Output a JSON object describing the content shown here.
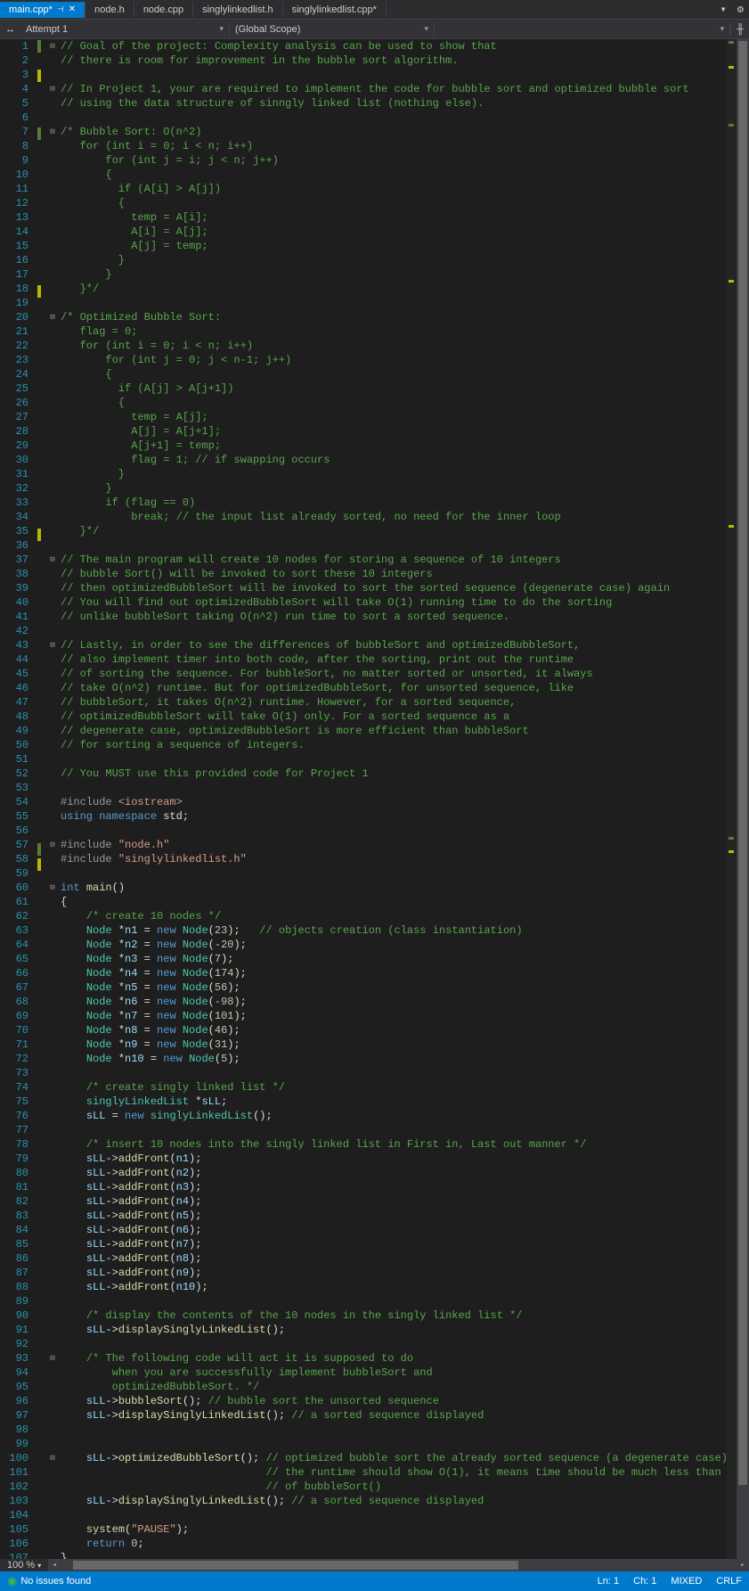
{
  "tabs": {
    "active": "main.cpp*",
    "others": [
      "node.h",
      "node.cpp",
      "singlylinkedlist.h",
      "singlylinkedlist.cpp*"
    ]
  },
  "navbar": {
    "project": "Attempt 1",
    "scope": "(Global Scope)",
    "member": ""
  },
  "statusbar": {
    "issues": "No issues found",
    "zoom": "100 %",
    "line": "Ln: 1",
    "char": "Ch: 1",
    "mode": "MIXED",
    "eol": "CRLF"
  },
  "code": [
    {
      "n": 1,
      "f": "⊟",
      "m": "g",
      "h": "<span class='c-comment'>// Goal of the project: Complexity analysis can be used to show that</span>"
    },
    {
      "n": 2,
      "h": "<span class='c-comment'>// there is room for improvement in the bubble sort algorithm.</span>"
    },
    {
      "n": 3,
      "m": "y",
      "h": ""
    },
    {
      "n": 4,
      "f": "⊟",
      "h": "<span class='c-comment'>// In Project 1, your are required to implement the code for bubble sort and optimized bubble sort</span>"
    },
    {
      "n": 5,
      "h": "<span class='c-comment'>// using the data structure of sinngly linked list (nothing else).</span>"
    },
    {
      "n": 6,
      "h": ""
    },
    {
      "n": 7,
      "f": "⊟",
      "m": "g",
      "h": "<span class='c-comment'>/* Bubble Sort: O(n^2)</span>"
    },
    {
      "n": 8,
      "h": "<span class='c-comment'>   for (int i = 0; i &lt; n; i++)</span>"
    },
    {
      "n": 9,
      "h": "<span class='c-comment'>       for (int j = i; j &lt; n; j++)</span>"
    },
    {
      "n": 10,
      "h": "<span class='c-comment'>       {</span>"
    },
    {
      "n": 11,
      "h": "<span class='c-comment'>         if (A[i] &gt; A[j])</span>"
    },
    {
      "n": 12,
      "h": "<span class='c-comment'>         {</span>"
    },
    {
      "n": 13,
      "h": "<span class='c-comment'>           temp = A[i];</span>"
    },
    {
      "n": 14,
      "h": "<span class='c-comment'>           A[i] = A[j];</span>"
    },
    {
      "n": 15,
      "h": "<span class='c-comment'>           A[j] = temp;</span>"
    },
    {
      "n": 16,
      "h": "<span class='c-comment'>         }</span>"
    },
    {
      "n": 17,
      "h": "<span class='c-comment'>       }</span>"
    },
    {
      "n": 18,
      "m": "y",
      "h": "<span class='c-comment'>   }*/</span>"
    },
    {
      "n": 19,
      "h": ""
    },
    {
      "n": 20,
      "f": "⊟",
      "h": "<span class='c-comment'>/* Optimized Bubble Sort:</span>"
    },
    {
      "n": 21,
      "h": "<span class='c-comment'>   flag = 0;</span>"
    },
    {
      "n": 22,
      "h": "<span class='c-comment'>   for (int i = 0; i &lt; n; i++)</span>"
    },
    {
      "n": 23,
      "h": "<span class='c-comment'>       for (int j = 0; j &lt; n-1; j++)</span>"
    },
    {
      "n": 24,
      "h": "<span class='c-comment'>       {</span>"
    },
    {
      "n": 25,
      "h": "<span class='c-comment'>         if (A[j] &gt; A[j+1])</span>"
    },
    {
      "n": 26,
      "h": "<span class='c-comment'>         {</span>"
    },
    {
      "n": 27,
      "h": "<span class='c-comment'>           temp = A[j];</span>"
    },
    {
      "n": 28,
      "h": "<span class='c-comment'>           A[j] = A[j+1];</span>"
    },
    {
      "n": 29,
      "h": "<span class='c-comment'>           A[j+1] = temp;</span>"
    },
    {
      "n": 30,
      "h": "<span class='c-comment'>           flag = 1; // if swapping occurs</span>"
    },
    {
      "n": 31,
      "h": "<span class='c-comment'>         }</span>"
    },
    {
      "n": 32,
      "h": "<span class='c-comment'>       }</span>"
    },
    {
      "n": 33,
      "h": "<span class='c-comment'>       if (flag == 0)</span>"
    },
    {
      "n": 34,
      "h": "<span class='c-comment'>           break; // the input list already sorted, no need for the inner loop</span>"
    },
    {
      "n": 35,
      "m": "y",
      "h": "<span class='c-comment'>   }*/</span>"
    },
    {
      "n": 36,
      "h": ""
    },
    {
      "n": 37,
      "f": "⊟",
      "h": "<span class='c-comment'>// The main program will create 10 nodes for storing a sequence of 10 integers</span>"
    },
    {
      "n": 38,
      "h": "<span class='c-comment'>// bubble Sort() will be invoked to sort these 10 integers</span>"
    },
    {
      "n": 39,
      "h": "<span class='c-comment'>// then optimizedBubbleSort will be invoked to sort the sorted sequence (degenerate case) again</span>"
    },
    {
      "n": 40,
      "h": "<span class='c-comment'>// You will find out optimizedBubbleSort will take O(1) running time to do the sorting</span>"
    },
    {
      "n": 41,
      "h": "<span class='c-comment'>// unlike bubbleSort taking O(n^2) run time to sort a sorted sequence.</span>"
    },
    {
      "n": 42,
      "h": ""
    },
    {
      "n": 43,
      "f": "⊟",
      "h": "<span class='c-comment'>// Lastly, in order to see the differences of bubbleSort and optimizedBubbleSort,</span>"
    },
    {
      "n": 44,
      "h": "<span class='c-comment'>// also implement timer into both code, after the sorting, print out the runtime</span>"
    },
    {
      "n": 45,
      "h": "<span class='c-comment'>// of sorting the sequence. For bubbleSort, no matter sorted or unsorted, it always</span>"
    },
    {
      "n": 46,
      "h": "<span class='c-comment'>// take O(n^2) runtime. But for optimizedBubbleSort, for unsorted sequence, like</span>"
    },
    {
      "n": 47,
      "h": "<span class='c-comment'>// bubbleSort, it takes O(n^2) runtime. However, for a sorted sequence,</span>"
    },
    {
      "n": 48,
      "h": "<span class='c-comment'>// optimizedBubbleSort will take O(1) only. For a sorted sequence as a</span>"
    },
    {
      "n": 49,
      "h": "<span class='c-comment'>// degenerate case, optimizedBubbleSort is more efficient than bubbleSort</span>"
    },
    {
      "n": 50,
      "h": "<span class='c-comment'>// for sorting a sequence of integers.</span>"
    },
    {
      "n": 51,
      "h": ""
    },
    {
      "n": 52,
      "h": "<span class='c-comment'>// You MUST use this provided code for Project 1</span>"
    },
    {
      "n": 53,
      "h": ""
    },
    {
      "n": 54,
      "h": "<span class='c-pre'>#include</span> <span class='c-str'>&lt;iostream&gt;</span>"
    },
    {
      "n": 55,
      "h": "<span class='c-kw'>using</span> <span class='c-kw'>namespace</span> std;"
    },
    {
      "n": 56,
      "h": ""
    },
    {
      "n": 57,
      "f": "⊟",
      "m": "g",
      "h": "<span class='c-pre'>#include</span> <span class='c-str'>\"node.h\"</span>"
    },
    {
      "n": 58,
      "m": "y",
      "h": "<span class='c-pre'>#include</span> <span class='c-str'>\"singlylinkedlist.h\"</span>"
    },
    {
      "n": 59,
      "h": ""
    },
    {
      "n": 60,
      "f": "⊟",
      "h": "<span class='c-kw'>int</span> <span class='c-func'>main</span>()"
    },
    {
      "n": 61,
      "h": "{"
    },
    {
      "n": 62,
      "h": "    <span class='c-comment'>/* create 10 nodes */</span>"
    },
    {
      "n": 63,
      "h": "    <span class='c-cls'>Node</span> *<span class='c-var'>n1</span> = <span class='c-kw'>new</span> <span class='c-cls'>Node</span>(<span class='c-num'>23</span>);   <span class='c-comment'>// objects creation (class instantiation)</span>"
    },
    {
      "n": 64,
      "h": "    <span class='c-cls'>Node</span> *<span class='c-var'>n2</span> = <span class='c-kw'>new</span> <span class='c-cls'>Node</span>(<span class='c-op'>-</span><span class='c-num'>20</span>);"
    },
    {
      "n": 65,
      "h": "    <span class='c-cls'>Node</span> *<span class='c-var'>n3</span> = <span class='c-kw'>new</span> <span class='c-cls'>Node</span>(<span class='c-num'>7</span>);"
    },
    {
      "n": 66,
      "h": "    <span class='c-cls'>Node</span> *<span class='c-var'>n4</span> = <span class='c-kw'>new</span> <span class='c-cls'>Node</span>(<span class='c-num'>174</span>);"
    },
    {
      "n": 67,
      "h": "    <span class='c-cls'>Node</span> *<span class='c-var'>n5</span> = <span class='c-kw'>new</span> <span class='c-cls'>Node</span>(<span class='c-num'>56</span>);"
    },
    {
      "n": 68,
      "h": "    <span class='c-cls'>Node</span> *<span class='c-var'>n6</span> = <span class='c-kw'>new</span> <span class='c-cls'>Node</span>(<span class='c-op'>-</span><span class='c-num'>98</span>);"
    },
    {
      "n": 69,
      "h": "    <span class='c-cls'>Node</span> *<span class='c-var'>n7</span> = <span class='c-kw'>new</span> <span class='c-cls'>Node</span>(<span class='c-num'>101</span>);"
    },
    {
      "n": 70,
      "h": "    <span class='c-cls'>Node</span> *<span class='c-var'>n8</span> = <span class='c-kw'>new</span> <span class='c-cls'>Node</span>(<span class='c-num'>46</span>);"
    },
    {
      "n": 71,
      "h": "    <span class='c-cls'>Node</span> *<span class='c-var'>n9</span> = <span class='c-kw'>new</span> <span class='c-cls'>Node</span>(<span class='c-num'>31</span>);"
    },
    {
      "n": 72,
      "h": "    <span class='c-cls'>Node</span> *<span class='c-var'>n10</span> = <span class='c-kw'>new</span> <span class='c-cls'>Node</span>(<span class='c-num'>5</span>);"
    },
    {
      "n": 73,
      "h": ""
    },
    {
      "n": 74,
      "h": "    <span class='c-comment'>/* create singly linked list */</span>"
    },
    {
      "n": 75,
      "h": "    <span class='c-cls'>singlyLinkedList</span> *<span class='c-var'>sLL</span>;"
    },
    {
      "n": 76,
      "h": "    <span class='c-var'>sLL</span> = <span class='c-kw'>new</span> <span class='c-cls'>singlyLinkedList</span>();"
    },
    {
      "n": 77,
      "h": ""
    },
    {
      "n": 78,
      "h": "    <span class='c-comment'>/* insert 10 nodes into the singly linked list in First in, Last out manner */</span>"
    },
    {
      "n": 79,
      "h": "    <span class='c-var'>sLL</span>-&gt;<span class='c-func'>addFront</span>(<span class='c-var'>n1</span>);"
    },
    {
      "n": 80,
      "h": "    <span class='c-var'>sLL</span>-&gt;<span class='c-func'>addFront</span>(<span class='c-var'>n2</span>);"
    },
    {
      "n": 81,
      "h": "    <span class='c-var'>sLL</span>-&gt;<span class='c-func'>addFront</span>(<span class='c-var'>n3</span>);"
    },
    {
      "n": 82,
      "h": "    <span class='c-var'>sLL</span>-&gt;<span class='c-func'>addFront</span>(<span class='c-var'>n4</span>);"
    },
    {
      "n": 83,
      "h": "    <span class='c-var'>sLL</span>-&gt;<span class='c-func'>addFront</span>(<span class='c-var'>n5</span>);"
    },
    {
      "n": 84,
      "h": "    <span class='c-var'>sLL</span>-&gt;<span class='c-func'>addFront</span>(<span class='c-var'>n6</span>);"
    },
    {
      "n": 85,
      "h": "    <span class='c-var'>sLL</span>-&gt;<span class='c-func'>addFront</span>(<span class='c-var'>n7</span>);"
    },
    {
      "n": 86,
      "h": "    <span class='c-var'>sLL</span>-&gt;<span class='c-func'>addFront</span>(<span class='c-var'>n8</span>);"
    },
    {
      "n": 87,
      "h": "    <span class='c-var'>sLL</span>-&gt;<span class='c-func'>addFront</span>(<span class='c-var'>n9</span>);"
    },
    {
      "n": 88,
      "h": "    <span class='c-var'>sLL</span>-&gt;<span class='c-func'>addFront</span>(<span class='c-var'>n10</span>);"
    },
    {
      "n": 89,
      "h": ""
    },
    {
      "n": 90,
      "h": "    <span class='c-comment'>/* display the contents of the 10 nodes in the singly linked list */</span>"
    },
    {
      "n": 91,
      "h": "    <span class='c-var'>sLL</span>-&gt;<span class='c-func'>displaySinglyLinkedList</span>();"
    },
    {
      "n": 92,
      "h": ""
    },
    {
      "n": 93,
      "f": "⊟",
      "h": "    <span class='c-comment'>/* The following code will act it is supposed to do</span>"
    },
    {
      "n": 94,
      "h": "    <span class='c-comment'>    when you are successfully implement bubbleSort and</span>"
    },
    {
      "n": 95,
      "h": "    <span class='c-comment'>    optimizedBubbleSort. */</span>"
    },
    {
      "n": 96,
      "h": "    <span class='c-var'>sLL</span>-&gt;<span class='c-func'>bubbleSort</span>(); <span class='c-comment'>// bubble sort the unsorted sequence</span>"
    },
    {
      "n": 97,
      "h": "    <span class='c-var'>sLL</span>-&gt;<span class='c-func'>displaySinglyLinkedList</span>(); <span class='c-comment'>// a sorted sequence displayed</span>"
    },
    {
      "n": 98,
      "h": ""
    },
    {
      "n": 99,
      "h": ""
    },
    {
      "n": 100,
      "f": "⊟",
      "h": "    <span class='c-var'>sLL</span>-&gt;<span class='c-func'>optimizedBubbleSort</span>(); <span class='c-comment'>// optimized bubble sort the already sorted sequence (a degenerate case)</span>"
    },
    {
      "n": 101,
      "h": "                                <span class='c-comment'>// the runtime should show O(1), it means time should be much less than</span>"
    },
    {
      "n": 102,
      "h": "                                <span class='c-comment'>// of bubbleSort()</span>"
    },
    {
      "n": 103,
      "h": "    <span class='c-var'>sLL</span>-&gt;<span class='c-func'>displaySinglyLinkedList</span>(); <span class='c-comment'>// a sorted sequence displayed</span>"
    },
    {
      "n": 104,
      "h": ""
    },
    {
      "n": 105,
      "h": "    <span class='c-func'>system</span>(<span class='c-str'>\"PAUSE\"</span>);"
    },
    {
      "n": 106,
      "h": "    <span class='c-kw'>return</span> <span class='c-num'>0</span>;"
    },
    {
      "n": 107,
      "h": "}"
    }
  ]
}
